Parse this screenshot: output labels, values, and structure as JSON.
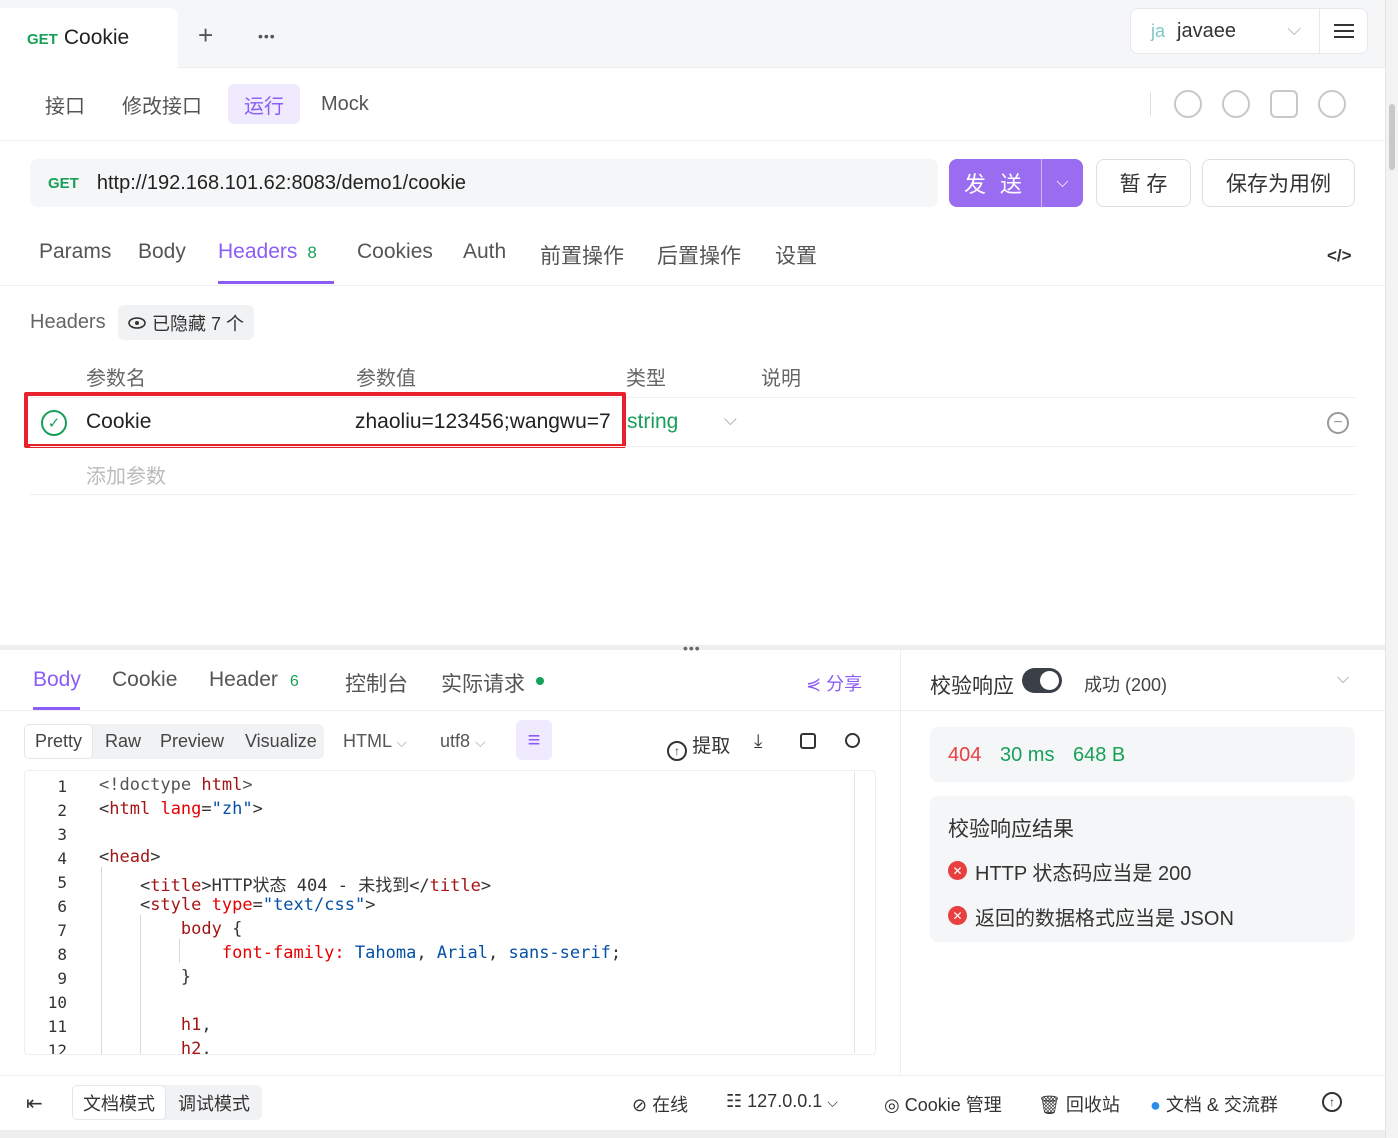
{
  "tab": {
    "method": "GET",
    "name": "Cookie",
    "add": "+",
    "more": "•••"
  },
  "workspace": {
    "badge": "ja",
    "name": "javaee"
  },
  "subtabs": [
    "接口",
    "修改接口",
    "运行",
    "Mock"
  ],
  "request": {
    "method": "GET",
    "url": "http://192.168.101.62:8083/demo1/cookie",
    "send": "发 送",
    "save_temp": "暂 存",
    "save_case": "保存为用例"
  },
  "req_tabs": {
    "params": "Params",
    "body": "Body",
    "headers": "Headers",
    "headers_count": "8",
    "cookies": "Cookies",
    "auth": "Auth",
    "pre": "前置操作",
    "post": "后置操作",
    "settings": "设置"
  },
  "headers": {
    "label": "Headers",
    "hidden": "已隐藏 7 个",
    "columns": {
      "name": "参数名",
      "value": "参数值",
      "type": "类型",
      "desc": "说明"
    },
    "row": {
      "name": "Cookie",
      "value": "zhaoliu=123456;wangwu=7",
      "type": "string"
    },
    "add": "添加参数"
  },
  "response": {
    "tabs": {
      "body": "Body",
      "cookie": "Cookie",
      "header": "Header",
      "header_count": "6",
      "console": "控制台",
      "actual": "实际请求"
    },
    "share": "分享",
    "formats": [
      "Pretty",
      "Raw",
      "Preview",
      "Visualize"
    ],
    "type_select": "HTML",
    "encoding": "utf8",
    "extract": "提取"
  },
  "code_lines": [
    "1",
    "2",
    "3",
    "4",
    "5",
    "6",
    "7",
    "8",
    "9",
    "10",
    "11",
    "12"
  ],
  "validation": {
    "title": "校验响应",
    "status": "成功 (200)",
    "code": "404",
    "time": "30 ms",
    "size": "648 B",
    "result_title": "校验响应结果",
    "errors": [
      "HTTP 状态码应当是 200",
      "返回的数据格式应当是 JSON"
    ]
  },
  "footer": {
    "modes": [
      "文档模式",
      "调试模式"
    ],
    "online": "在线",
    "host": "127.0.0.1",
    "cookie_mgr": "Cookie 管理",
    "recycle": "回收站",
    "docs": "文档 & 交流群"
  },
  "colors": {
    "accent": "#8b5cf6",
    "green": "#18a058",
    "red": "#e84040",
    "highlight": "#e8222c"
  }
}
